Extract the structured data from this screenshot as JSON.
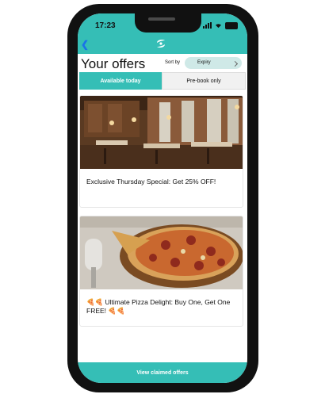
{
  "status_bar": {
    "time": "17:23"
  },
  "header": {
    "title": "Your offers",
    "sort_label": "Sort by",
    "sort_value": "Expiry"
  },
  "tabs": [
    {
      "label": "Available today",
      "active": true
    },
    {
      "label": "Pre-book only",
      "active": false
    }
  ],
  "offers": [
    {
      "text": "  Exclusive Thursday Special: Get 25% OFF!",
      "image": "restaurant-interior-image"
    },
    {
      "text": "🍕🍕 Ultimate Pizza Delight: Buy One, Get One FREE! 🍕🍕",
      "image": "pizza-image"
    }
  ],
  "footer": {
    "button_label": "View claimed offers"
  },
  "colors": {
    "accent": "#35beb6",
    "sort_bg": "#cfe9e7",
    "back": "#1a73e8"
  },
  "icons": [
    "chevron-left-icon",
    "app-logo-icon",
    "signal-icon",
    "wifi-icon",
    "battery-icon"
  ]
}
